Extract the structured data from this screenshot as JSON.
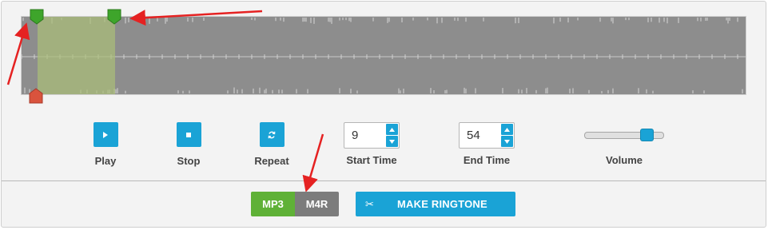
{
  "controls": {
    "play_label": "Play",
    "stop_label": "Stop",
    "repeat_label": "Repeat",
    "start_time_label": "Start Time",
    "start_time_value": "9",
    "end_time_label": "End Time",
    "end_time_value": "54",
    "volume_label": "Volume",
    "volume_level_fraction": 0.8
  },
  "format": {
    "mp3_label": "MP3",
    "m4r_label": "M4R",
    "selected": "MP3"
  },
  "make_ringtone_label": "MAKE RINGTONE",
  "colors": {
    "accent": "#1aa3d6",
    "mp3_green": "#5fb137",
    "m4r_gray": "#7c7c7c",
    "marker_green": "#3ea52b",
    "marker_red": "#d9533d",
    "annotation_arrow": "#e52222",
    "waveform": "#8d8d8d",
    "selection": "#aabe78"
  },
  "icons": {
    "play": "play-icon",
    "stop": "stop-icon",
    "repeat": "repeat-icon",
    "scissors": "scissors-icon",
    "spin_up": "chevron-up-icon",
    "spin_down": "chevron-down-icon"
  }
}
